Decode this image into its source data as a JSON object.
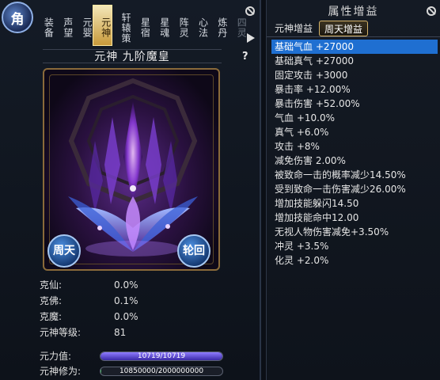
{
  "left": {
    "emblem": "角",
    "tabs": [
      {
        "label": "装备",
        "state": "normal"
      },
      {
        "label": "声望",
        "state": "normal"
      },
      {
        "label": "元婴",
        "state": "normal"
      },
      {
        "label": "元神",
        "state": "active"
      },
      {
        "label": "轩辕策",
        "state": "normal"
      },
      {
        "label": "星宿",
        "state": "normal"
      },
      {
        "label": "星魂",
        "state": "normal"
      },
      {
        "label": "阵灵",
        "state": "normal"
      },
      {
        "label": "心法",
        "state": "normal"
      },
      {
        "label": "炼丹",
        "state": "normal"
      },
      {
        "label": "四灵",
        "state": "dim"
      }
    ],
    "help": "?",
    "spirit_name": "元神 九阶魔皇",
    "zhoutian_button": "周天",
    "lunhui_button": "轮回",
    "stats": [
      {
        "label": "克仙:",
        "value": "0.0%"
      },
      {
        "label": "克佛:",
        "value": "0.1%"
      },
      {
        "label": "克魔:",
        "value": "0.0%"
      },
      {
        "label": "元神等级:",
        "value": "81"
      }
    ],
    "power": {
      "label": "元力值:",
      "text": "10719/10719",
      "fraction": 1.0
    },
    "cultivation": {
      "label": "元神修为:",
      "text": "10850000/2000000000",
      "fraction": 0.005
    }
  },
  "right": {
    "title": "属性增益",
    "tabs": [
      {
        "label": "元神增益",
        "active": false
      },
      {
        "label": "周天增益",
        "active": true
      }
    ],
    "attributes": [
      "基础气血 +27000",
      "基础真气 +27000",
      "固定攻击 +3000",
      "暴击率 +12.00%",
      "暴击伤害 +52.00%",
      "气血 +10.0%",
      "真气 +6.0%",
      "攻击 +8%",
      "减免伤害 2.00%",
      "被致命一击的概率减少14.50%",
      "受到致命一击伤害减少26.00%",
      "增加技能躲闪14.50",
      "增加技能命中12.00",
      "无视人物伤害减免+3.50%",
      "冲灵 +3.5%",
      "化灵 +2.0%"
    ],
    "selected_index": 0
  },
  "colors": {
    "selected_row": "#1f6fd1",
    "active_tab": "#c89a3b",
    "power_bar": "#6a5cff",
    "cultivation_bar": "#2fa84f"
  }
}
